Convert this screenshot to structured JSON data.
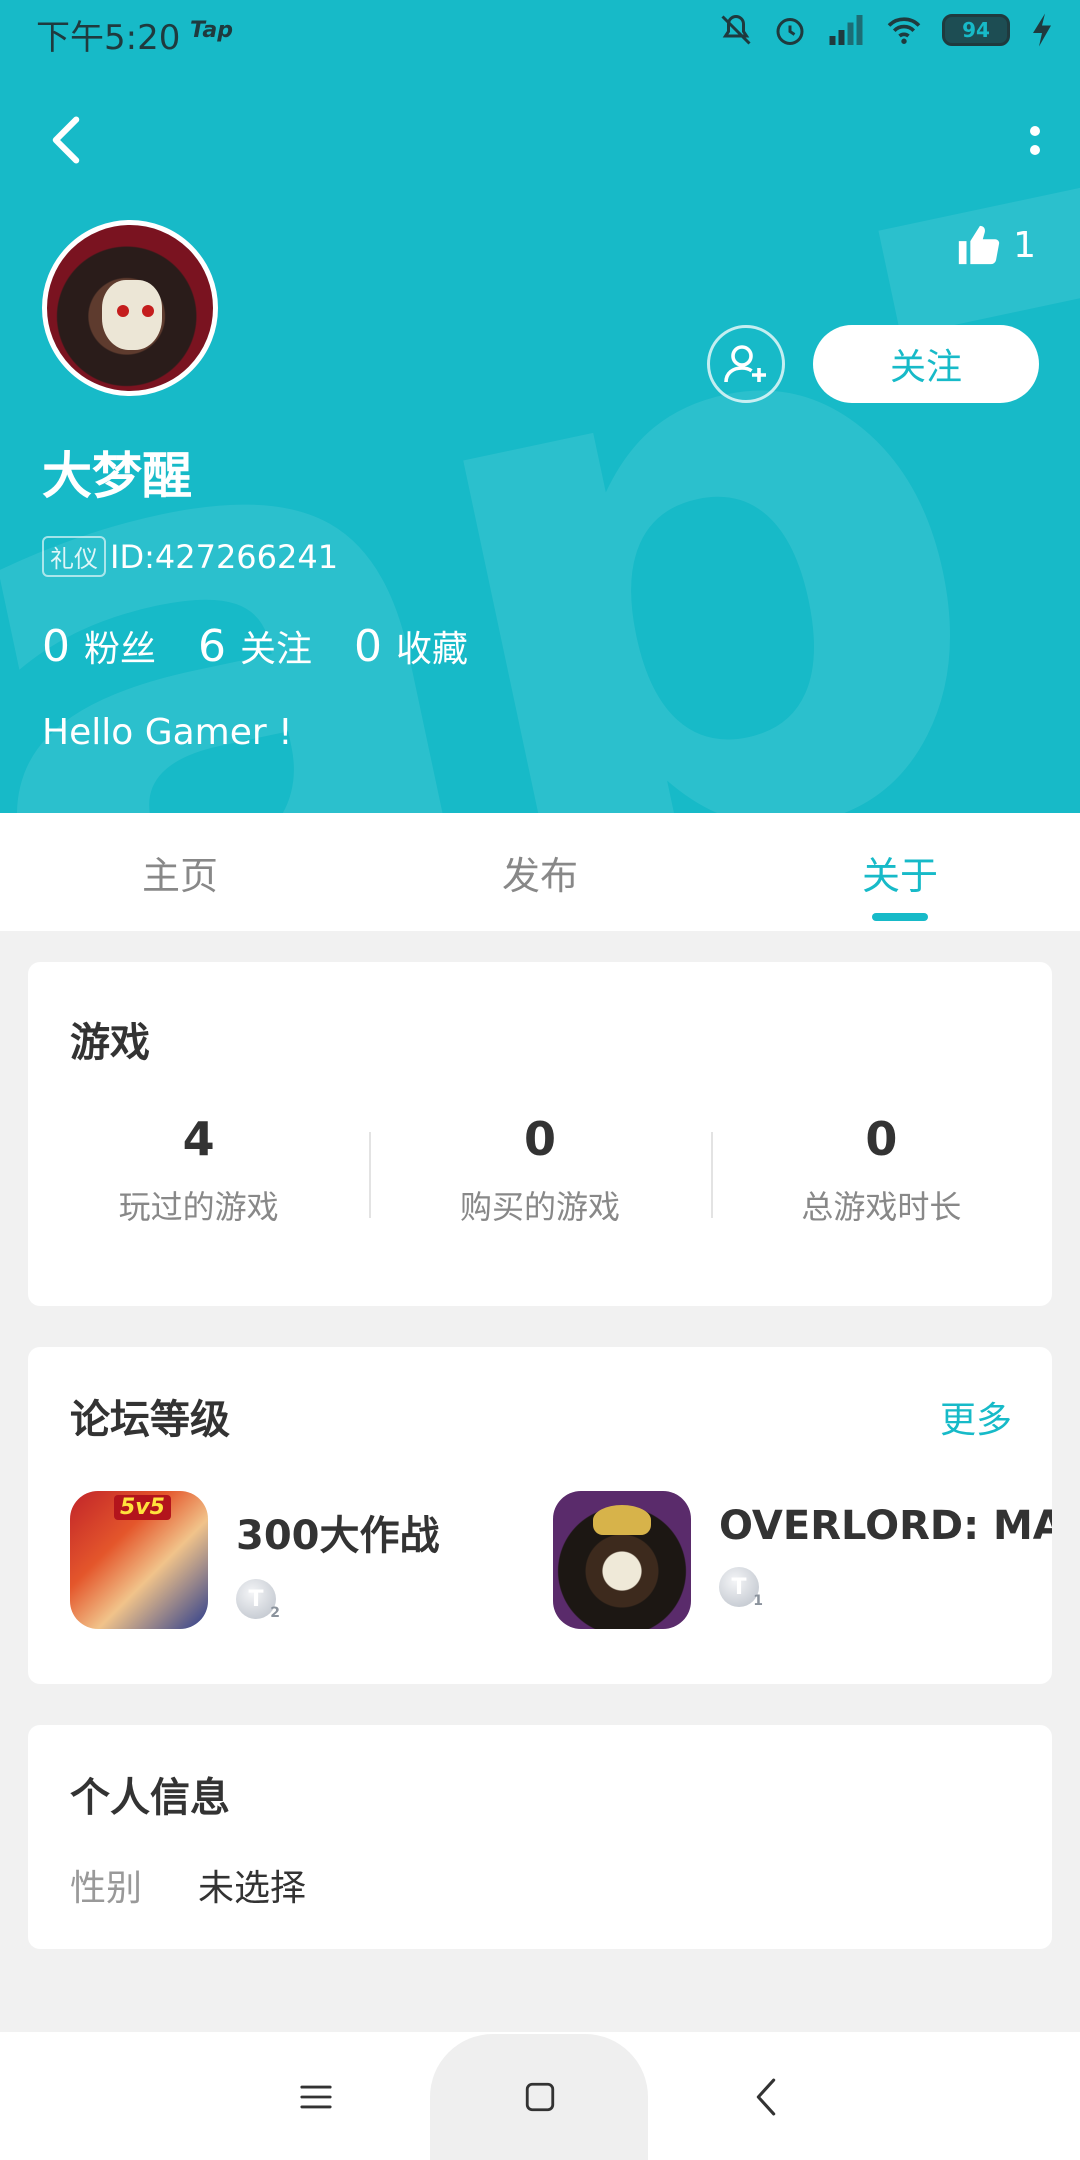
{
  "status_bar": {
    "time": "下午5:20",
    "carrier": "Tap",
    "battery": "94"
  },
  "profile": {
    "like_count": "1",
    "follow_label": "关注",
    "username": "大梦醒",
    "id_badge": "礼仪",
    "id_text": "ID:427266241",
    "stats": [
      {
        "num": "0",
        "label": "粉丝"
      },
      {
        "num": "6",
        "label": "关注"
      },
      {
        "num": "0",
        "label": "收藏"
      }
    ],
    "bio": "Hello Gamer !"
  },
  "tabs": [
    {
      "label": "主页"
    },
    {
      "label": "发布"
    },
    {
      "label": "关于"
    }
  ],
  "games_card": {
    "title": "游戏",
    "stats": [
      {
        "num": "4",
        "label": "玩过的游戏"
      },
      {
        "num": "0",
        "label": "购买的游戏"
      },
      {
        "num": "0",
        "label": "总游戏时长"
      }
    ]
  },
  "forum_card": {
    "title": "论坛等级",
    "more": "更多",
    "items": [
      {
        "name": "300大作战",
        "icon_tag": "5v5",
        "level": "T",
        "level_num": "2"
      },
      {
        "name": "OVERLORD: MASS FOR THE DEAD",
        "level": "T",
        "level_num": "1"
      }
    ]
  },
  "info_card": {
    "title": "个人信息",
    "gender_label": "性别",
    "gender_value": "未选择"
  },
  "colors": {
    "accent": "#17bac8",
    "background": "#f1f1f1"
  }
}
